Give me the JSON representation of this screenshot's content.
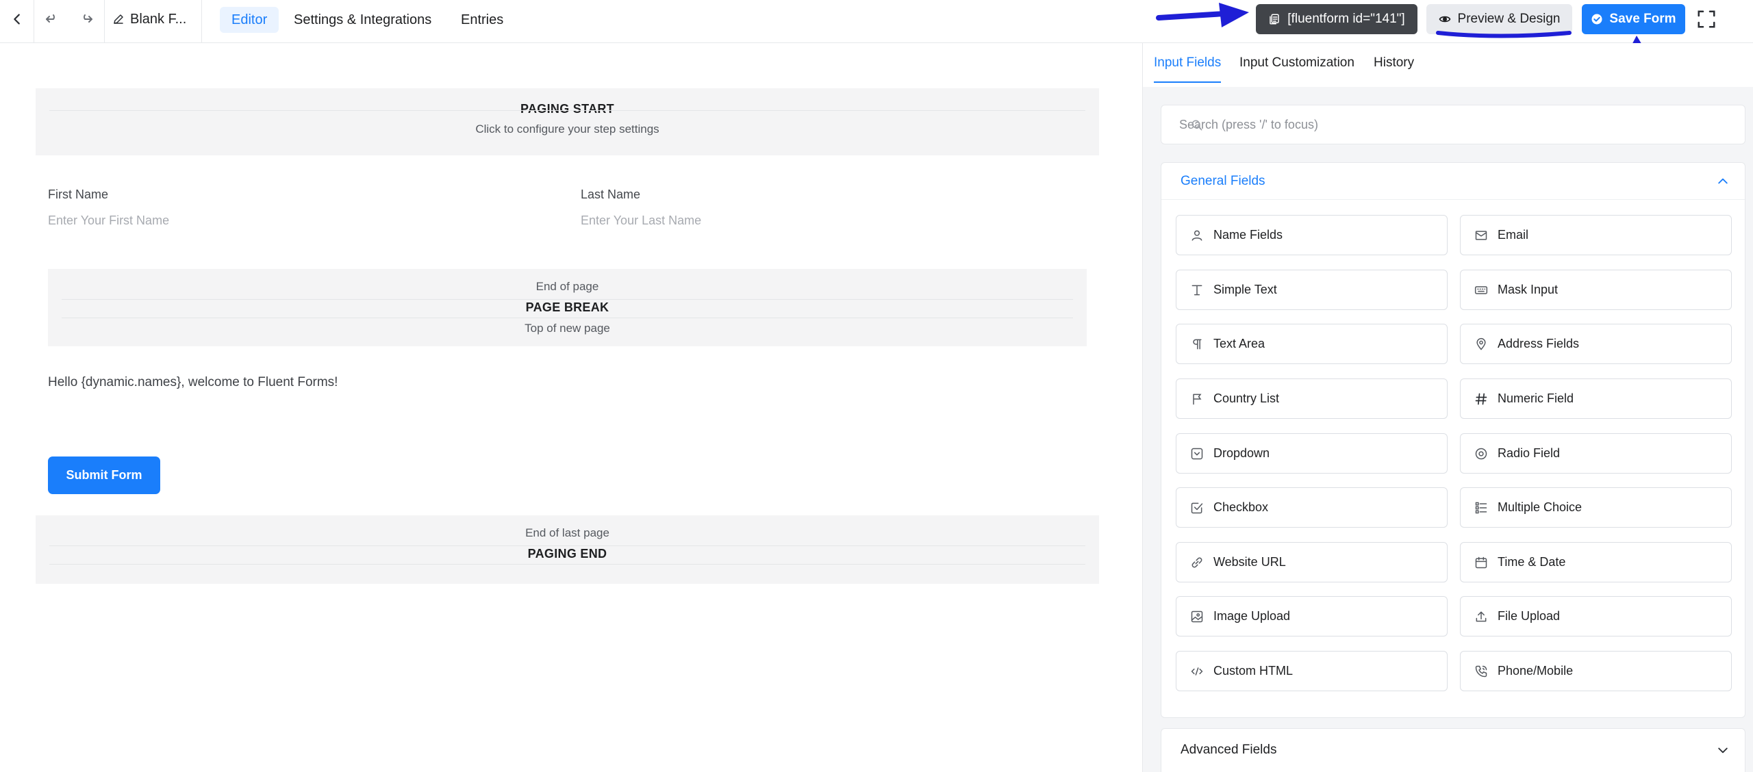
{
  "header": {
    "back_icon": "chevron-left-icon",
    "undo_icon": "undo-icon",
    "redo_icon": "redo-icon",
    "form_title": "Blank F...",
    "tabs": [
      {
        "label": "Editor",
        "active": true
      },
      {
        "label": "Settings & Integrations",
        "active": false
      },
      {
        "label": "Entries",
        "active": false
      }
    ],
    "shortcode_label": "[fluentform id=\"141\"]",
    "preview_label": "Preview & Design",
    "save_label": "Save Form"
  },
  "canvas": {
    "paging_start": {
      "title": "PAGING START",
      "subtitle": "Click to configure your step settings"
    },
    "first_name": {
      "label": "First Name",
      "placeholder": "Enter Your First Name"
    },
    "last_name": {
      "label": "Last Name",
      "placeholder": "Enter Your Last Name"
    },
    "page_break": {
      "top": "End of page",
      "title": "PAGE BREAK",
      "bottom": "Top of new page"
    },
    "html_text": "Hello {dynamic.names}, welcome to Fluent Forms!",
    "submit_label": "Submit Form",
    "paging_end": {
      "top": "End of last page",
      "title": "PAGING END"
    }
  },
  "sidebar": {
    "tabs": [
      {
        "label": "Input Fields",
        "active": true
      },
      {
        "label": "Input Customization",
        "active": false
      },
      {
        "label": "History",
        "active": false
      }
    ],
    "search_placeholder": "Search (press '/' to focus)",
    "general_title": "General Fields",
    "general_fields": [
      {
        "label": "Name Fields",
        "icon": "person-icon"
      },
      {
        "label": "Email",
        "icon": "envelope-icon"
      },
      {
        "label": "Simple Text",
        "icon": "text-cursor-icon"
      },
      {
        "label": "Mask Input",
        "icon": "keyboard-icon"
      },
      {
        "label": "Text Area",
        "icon": "paragraph-icon"
      },
      {
        "label": "Address Fields",
        "icon": "map-pin-icon"
      },
      {
        "label": "Country List",
        "icon": "flag-icon"
      },
      {
        "label": "Numeric Field",
        "icon": "hash-icon"
      },
      {
        "label": "Dropdown",
        "icon": "dropdown-icon"
      },
      {
        "label": "Radio Field",
        "icon": "radio-icon"
      },
      {
        "label": "Checkbox",
        "icon": "checkbox-icon"
      },
      {
        "label": "Multiple Choice",
        "icon": "list-icon"
      },
      {
        "label": "Website URL",
        "icon": "link-icon"
      },
      {
        "label": "Time & Date",
        "icon": "calendar-icon"
      },
      {
        "label": "Image Upload",
        "icon": "image-icon"
      },
      {
        "label": "File Upload",
        "icon": "upload-icon"
      },
      {
        "label": "Custom HTML",
        "icon": "code-icon"
      },
      {
        "label": "Phone/Mobile",
        "icon": "phone-icon"
      }
    ],
    "advanced_title": "Advanced Fields"
  },
  "colors": {
    "accent": "#1a7efb",
    "dark_button": "#414449",
    "annotation": "#1f1fd6"
  }
}
